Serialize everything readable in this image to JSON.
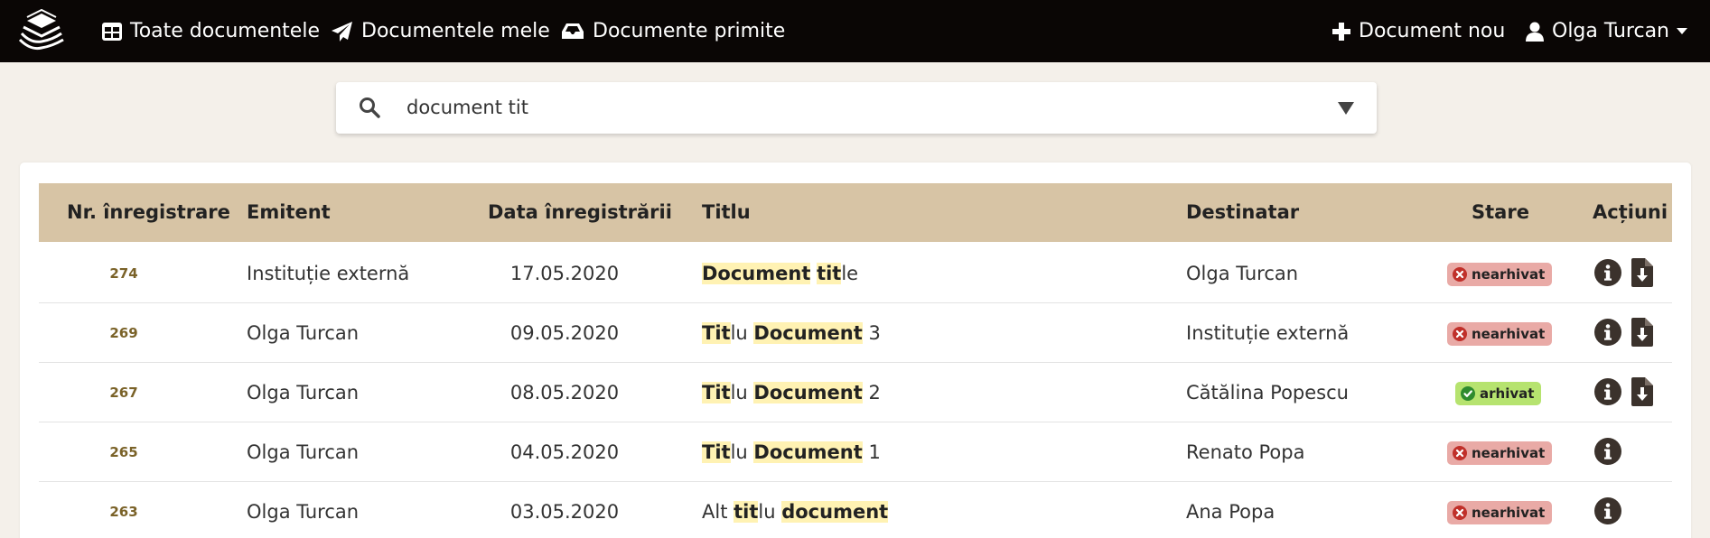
{
  "nav": {
    "logo_icon": "stacked-papers-logo",
    "all_documents": "Toate documentele",
    "my_documents": "Documentele mele",
    "received_documents": "Documente primite",
    "new_document": "Document nou",
    "user_name": "Olga Turcan"
  },
  "search": {
    "value": "document tit"
  },
  "table": {
    "headers": {
      "number": "Nr. înregistrare",
      "issuer": "Emitent",
      "date": "Data înregistrării",
      "title": "Titlu",
      "recipient": "Destinatar",
      "status": "Stare",
      "actions": "Acțiuni"
    },
    "rows": [
      {
        "number": "274",
        "issuer": "Instituție externă",
        "date": "17.05.2020",
        "title": [
          [
            "Document",
            true
          ],
          [
            " ",
            false
          ],
          [
            "tit",
            true
          ],
          [
            "le",
            false
          ]
        ],
        "recipient": "Olga Turcan",
        "status": "nearhivat",
        "status_type": "red",
        "download": true
      },
      {
        "number": "269",
        "issuer": "Olga Turcan",
        "date": "09.05.2020",
        "title": [
          [
            "Tit",
            true
          ],
          [
            "lu ",
            false
          ],
          [
            "Document",
            true
          ],
          [
            " 3",
            false
          ]
        ],
        "recipient": "Instituție externă",
        "status": "nearhivat",
        "status_type": "red",
        "download": true
      },
      {
        "number": "267",
        "issuer": "Olga Turcan",
        "date": "08.05.2020",
        "title": [
          [
            "Tit",
            true
          ],
          [
            "lu ",
            false
          ],
          [
            "Document",
            true
          ],
          [
            " 2",
            false
          ]
        ],
        "recipient": "Cătălina Popescu",
        "status": "arhivat",
        "status_type": "green",
        "download": true
      },
      {
        "number": "265",
        "issuer": "Olga Turcan",
        "date": "04.05.2020",
        "title": [
          [
            "Tit",
            true
          ],
          [
            "lu ",
            false
          ],
          [
            "Document",
            true
          ],
          [
            " 1",
            false
          ]
        ],
        "recipient": "Renato Popa",
        "status": "nearhivat",
        "status_type": "red",
        "download": false
      },
      {
        "number": "263",
        "issuer": "Olga Turcan",
        "date": "03.05.2020",
        "title": [
          [
            "Alt ",
            false
          ],
          [
            "tit",
            true
          ],
          [
            "lu ",
            false
          ],
          [
            "document",
            true
          ]
        ],
        "recipient": "Ana Popa",
        "status": "nearhivat",
        "status_type": "red",
        "download": false
      }
    ]
  }
}
